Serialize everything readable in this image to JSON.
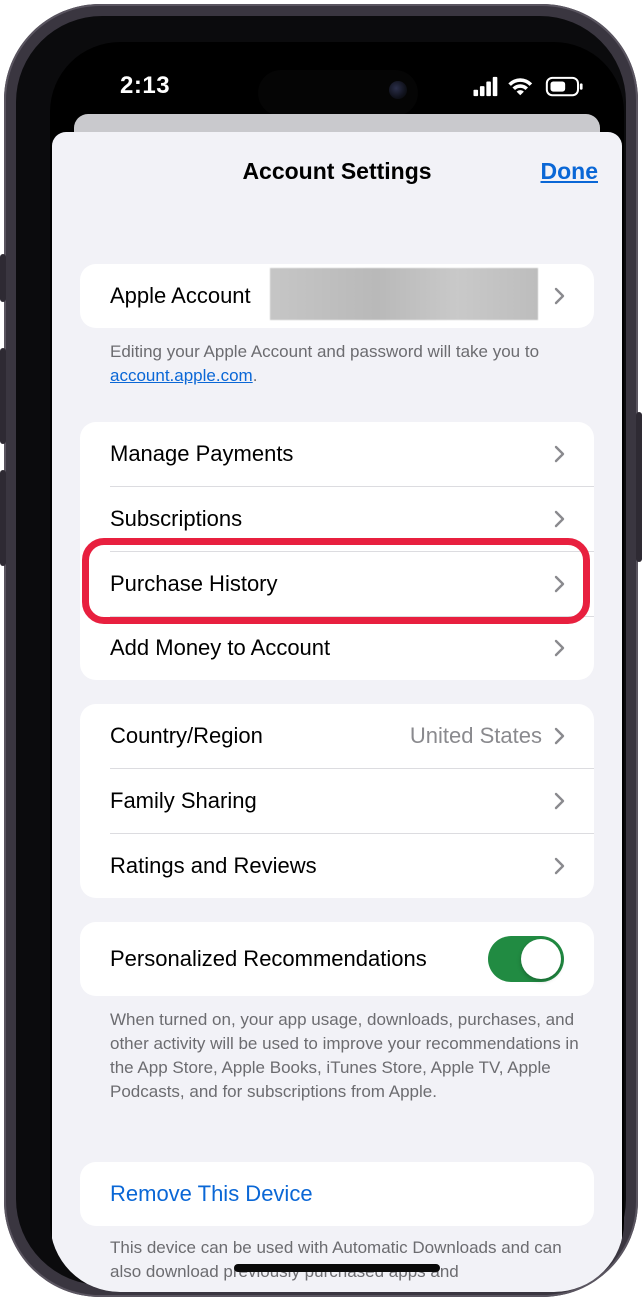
{
  "status_bar": {
    "time": "2:13"
  },
  "header": {
    "title": "Account Settings",
    "done_label": "Done"
  },
  "apple_account": {
    "label": "Apple Account",
    "footnote_text": "Editing your Apple Account and password will take you to ",
    "footnote_link": "account.apple.com",
    "footnote_end": "."
  },
  "group_purchases": {
    "items": [
      {
        "label": "Manage Payments"
      },
      {
        "label": "Subscriptions"
      },
      {
        "label": "Purchase History"
      },
      {
        "label": "Add Money to Account"
      }
    ]
  },
  "group_region": {
    "items": [
      {
        "label": "Country/Region",
        "value": "United States"
      },
      {
        "label": "Family Sharing"
      },
      {
        "label": "Ratings and Reviews"
      }
    ]
  },
  "recommendations": {
    "label": "Personalized Recommendations",
    "enabled": true,
    "footnote": "When turned on, your app usage, downloads, purchases, and other activity will be used to improve your recommendations in the App Store, Apple Books, iTunes Store, Apple TV, Apple Podcasts, and for subscriptions from Apple."
  },
  "device": {
    "remove_label": "Remove This Device",
    "footnote": "This device can be used with Automatic Downloads and can also download previously purchased apps and"
  },
  "colors": {
    "accent": "#0a67d6",
    "highlight": "#e8203f",
    "toggle_on": "#218b42",
    "background": "#f2f2f7"
  },
  "icons": [
    "chevron-right-icon",
    "signal-icon",
    "wifi-icon",
    "battery-icon"
  ]
}
